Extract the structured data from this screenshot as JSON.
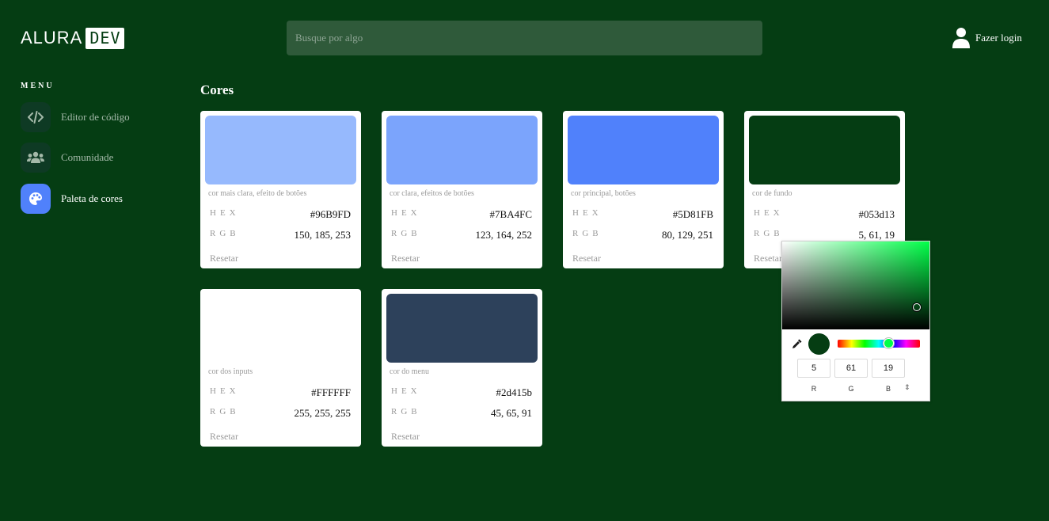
{
  "header": {
    "logo_text": "ALURA",
    "logo_badge": "DEV",
    "search_placeholder": "Busque por algo",
    "login_label": "Fazer login"
  },
  "sidebar": {
    "title": "MENU",
    "items": [
      {
        "label": "Editor de código",
        "icon": "code-icon",
        "active": false
      },
      {
        "label": "Comunidade",
        "icon": "users-icon",
        "active": false
      },
      {
        "label": "Paleta de cores",
        "icon": "palette-icon",
        "active": true
      }
    ]
  },
  "main": {
    "title": "Cores",
    "hex_label": "HEX",
    "rgb_label": "RGB",
    "reset_label": "Resetar",
    "cards": [
      {
        "description": "cor mais clara, efeito de botões",
        "hex": "#96B9FD",
        "rgb": "150, 185, 253",
        "color": "#96B9FD"
      },
      {
        "description": "cor clara, efeitos de botões",
        "hex": "#7BA4FC",
        "rgb": "123, 164, 252",
        "color": "#7BA4FC"
      },
      {
        "description": "cor principal, botões",
        "hex": "#5D81FB",
        "rgb": "80, 129, 251",
        "color": "#5081FB"
      },
      {
        "description": "cor de fundo",
        "hex": "#053d13",
        "rgb": "5, 61, 19",
        "color": "#053d13"
      },
      {
        "description": "cor dos inputs",
        "hex": "#FFFFFF",
        "rgb": "255, 255, 255",
        "color": "#FFFFFF"
      },
      {
        "description": "cor do menu",
        "hex": "#2d415b",
        "rgb": "45, 65, 91",
        "color": "#2d415b"
      }
    ]
  },
  "color_picker": {
    "r": "5",
    "g": "61",
    "b": "19",
    "r_label": "R",
    "g_label": "G",
    "b_label": "B",
    "mode_toggle": "⇕",
    "current_color": "#053d13",
    "hue_color": "#00ff48"
  }
}
